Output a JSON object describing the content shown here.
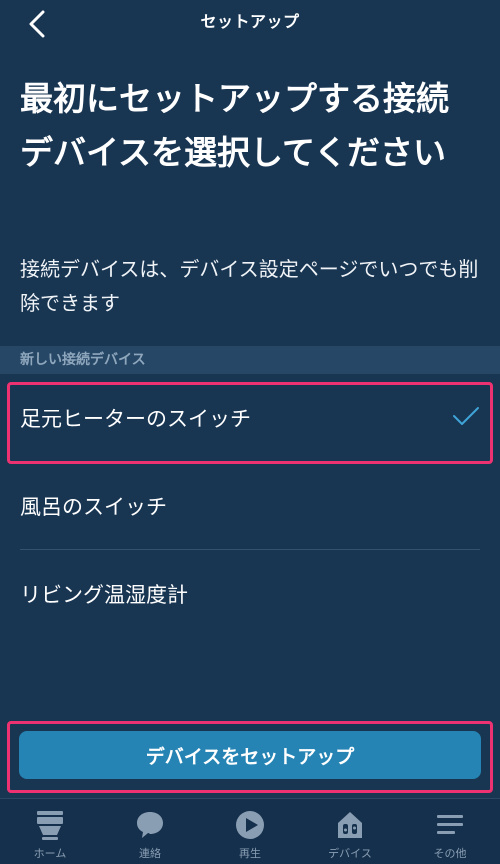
{
  "header": {
    "title": "セットアップ"
  },
  "page_title": "最初にセットアップする接続デバイスを選択してください",
  "description": "接続デバイスは、デバイス設定ページでいつでも削除できます",
  "section": {
    "label": "新しい接続デバイス"
  },
  "devices": [
    {
      "label": "足元ヒーターのスイッチ",
      "selected": true
    },
    {
      "label": "風呂のスイッチ",
      "selected": false
    },
    {
      "label": "リビング温湿度計",
      "selected": false
    }
  ],
  "setup_button": {
    "label": "デバイスをセットアップ"
  },
  "tabs": [
    {
      "label": "ホーム",
      "icon": "home-icon"
    },
    {
      "label": "連絡",
      "icon": "speech-bubble-icon"
    },
    {
      "label": "再生",
      "icon": "play-icon"
    },
    {
      "label": "デバイス",
      "icon": "devices-icon"
    },
    {
      "label": "その他",
      "icon": "menu-icon"
    }
  ],
  "colors": {
    "background": "#183552",
    "accent": "#2584b4",
    "highlight": "#ec3270",
    "check": "#3fa5d8"
  }
}
